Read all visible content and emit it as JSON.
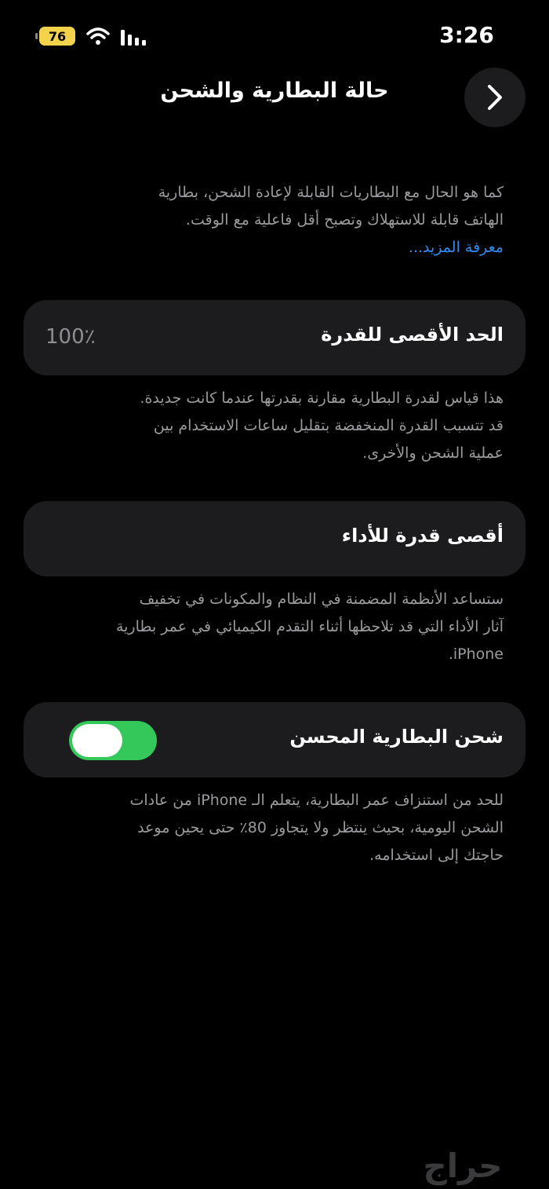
{
  "status_bar": {
    "battery_level": "76",
    "time": "3:26",
    "icons": [
      "battery-icon",
      "wifi-icon",
      "signal-icon"
    ]
  },
  "header": {
    "title": "حالة البطارية والشحن",
    "back_icon": "chevron-right-icon"
  },
  "intro": {
    "line1": "كما هو الحال مع البطاريات القابلة لإعادة الشحن، بطارية",
    "line2": "الهاتف قابلة للاستهلاك وتصبح أقل فاعلية مع الوقت.",
    "link": "معرفة المزيد..."
  },
  "maximum_capacity": {
    "label": "الحد الأقصى للقدرة",
    "value": "100٪",
    "desc_line1": "هذا قياس لقدرة البطارية مقارنة بقدرتها عندما كانت جديدة.",
    "desc_line2": "قد تتسبب القدرة المنخفضة بتقليل ساعات الاستخدام بين",
    "desc_line3": "عملية الشحن والأخرى."
  },
  "peak_performance": {
    "label": "أقصى قدرة للأداء",
    "desc_line1": "ستساعد الأنظمة المضمنة في النظام والمكونات في تخفيف",
    "desc_line2": "آثار الأداء التي قد تلاحظها أثناء التقدم الكيميائي في عمر بطارية",
    "desc_line3": "iPhone."
  },
  "optimized_charging": {
    "label": "شحن البطارية المحسن",
    "enabled": true,
    "desc_line1": "للحد من استنزاف عمر البطارية، يتعلم الـ iPhone من عادات",
    "desc_line2": "الشحن اليومية، بحيث ينتظر ولا يتجاوز 80٪ حتى يحين موعد",
    "desc_line3": "حاجتك إلى استخدامه."
  },
  "colors": {
    "background": "#000000",
    "card": "#1c1c1e",
    "secondary_text": "#9b9b9f",
    "link": "#2f8cf5",
    "toggle_on": "#34c759"
  },
  "watermark": "حراج"
}
